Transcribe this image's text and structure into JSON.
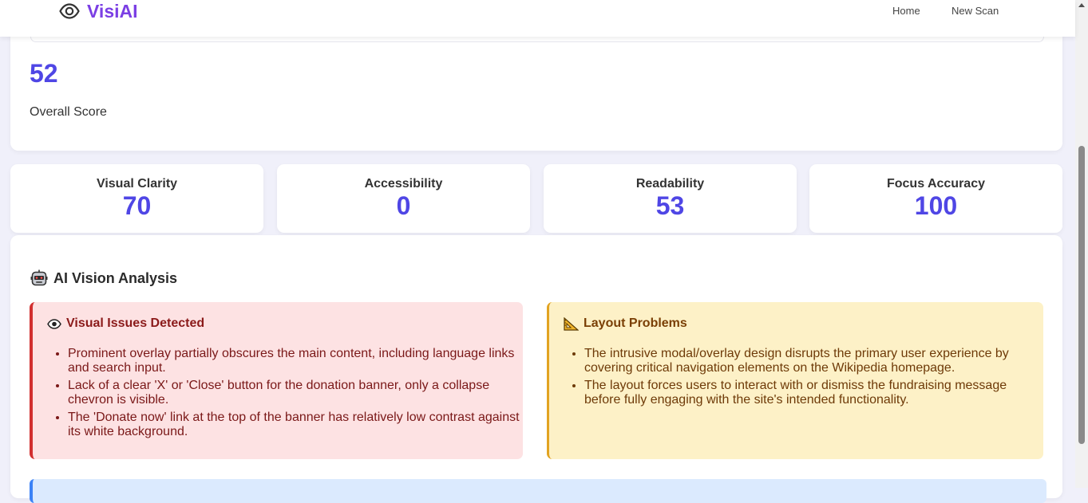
{
  "nav": {
    "brand": "VisiAI",
    "links": [
      "Home",
      "New Scan"
    ]
  },
  "overall": {
    "score": "52",
    "label": "Overall Score"
  },
  "metrics": [
    {
      "label": "Visual Clarity",
      "value": "70"
    },
    {
      "label": "Accessibility",
      "value": "0"
    },
    {
      "label": "Readability",
      "value": "53"
    },
    {
      "label": "Focus Accuracy",
      "value": "100"
    }
  ],
  "analysis": {
    "icon": "robot-face-icon",
    "title": "AI Vision Analysis",
    "visual_issues": {
      "icon": "eye-icon",
      "title": "Visual Issues Detected",
      "items": [
        "Prominent overlay partially obscures the main content, including language links and search input.",
        "Lack of a clear 'X' or 'Close' button for the donation banner, only a collapse chevron is visible.",
        "The 'Donate now' link at the top of the banner has relatively low contrast against its white background."
      ]
    },
    "layout_problems": {
      "icon": "triangular-ruler-icon",
      "title": "Layout Problems",
      "items": [
        "The intrusive modal/overlay design disrupts the primary user experience by covering critical navigation elements on the Wikipedia homepage.",
        "The layout forces users to interact with or dismiss the fundraising message before fully engaging with the site's intended functionality."
      ]
    }
  },
  "colors": {
    "brand": "#7b3fe4",
    "score": "#4f46e5",
    "visual_accent": "#d22f2f",
    "visual_bg": "#fde2e3",
    "layout_accent": "#e2a321",
    "layout_bg": "#fdf1c7"
  }
}
